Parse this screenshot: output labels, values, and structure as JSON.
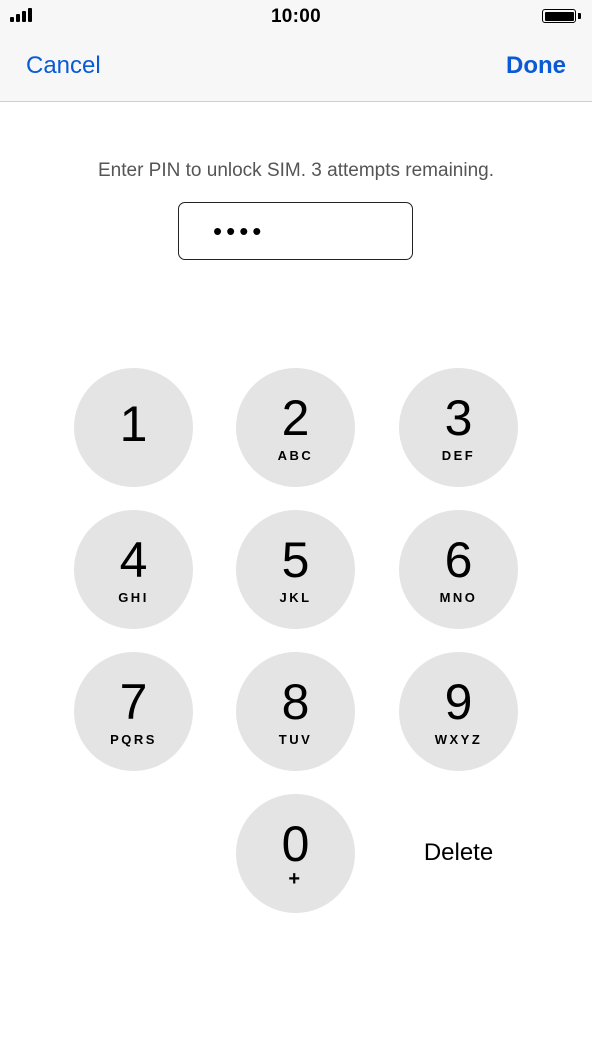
{
  "status_bar": {
    "time": "10:00",
    "signal_icon": "signal-bars-icon",
    "battery_icon": "battery-full-icon",
    "battery_level": 1.0
  },
  "nav": {
    "cancel_label": "Cancel",
    "done_label": "Done",
    "accent_color": "#0a5ad6"
  },
  "prompt": "Enter PIN to unlock SIM. 3 attempts remaining.",
  "pin_field": {
    "value_masked": "••••",
    "entered_digits": 4
  },
  "keypad": {
    "keys": [
      {
        "digit": "1",
        "letters": ""
      },
      {
        "digit": "2",
        "letters": "ABC"
      },
      {
        "digit": "3",
        "letters": "DEF"
      },
      {
        "digit": "4",
        "letters": "GHI"
      },
      {
        "digit": "5",
        "letters": "JKL"
      },
      {
        "digit": "6",
        "letters": "MNO"
      },
      {
        "digit": "7",
        "letters": "PQRS"
      },
      {
        "digit": "8",
        "letters": "TUV"
      },
      {
        "digit": "9",
        "letters": "WXYZ"
      },
      {
        "digit": "0",
        "letters": "+"
      }
    ],
    "delete_label": "Delete",
    "key_color": "#e4e4e4"
  }
}
